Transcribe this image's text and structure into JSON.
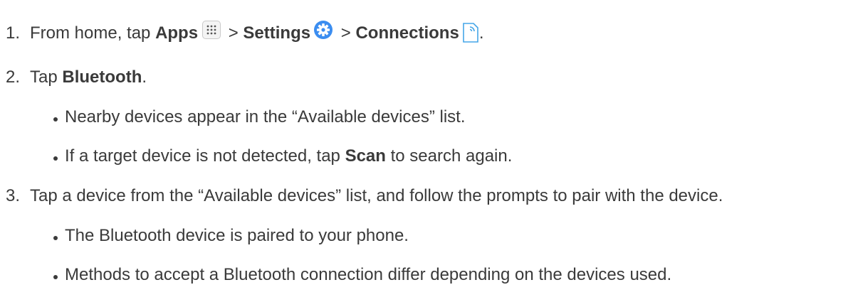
{
  "steps": [
    {
      "number": "1.",
      "parts": {
        "pre": "From home, tap ",
        "apps": "Apps",
        "sep1": " > ",
        "settings": "Settings",
        "sep2": " > ",
        "connections": "Connections",
        "end": "."
      }
    },
    {
      "number": "2.",
      "pre": "Tap ",
      "bold": "Bluetooth",
      "end": ".",
      "bullets": [
        {
          "text": "Nearby devices appear in the “Available devices” list."
        },
        {
          "pre": "If a target device is not detected, tap ",
          "bold": "Scan",
          "post": " to search again."
        }
      ]
    },
    {
      "number": "3.",
      "text": "Tap a device from the “Available devices” list, and follow the prompts to pair with the device.",
      "bullets": [
        {
          "text": "The Bluetooth device is paired to your phone."
        },
        {
          "text": "Methods to accept a Bluetooth connection differ depending on the devices used."
        }
      ]
    }
  ],
  "icons": {
    "apps": "apps-grid-icon",
    "settings": "settings-gear-icon",
    "connections": "connections-icon",
    "settings_color": "#3b8df0"
  }
}
